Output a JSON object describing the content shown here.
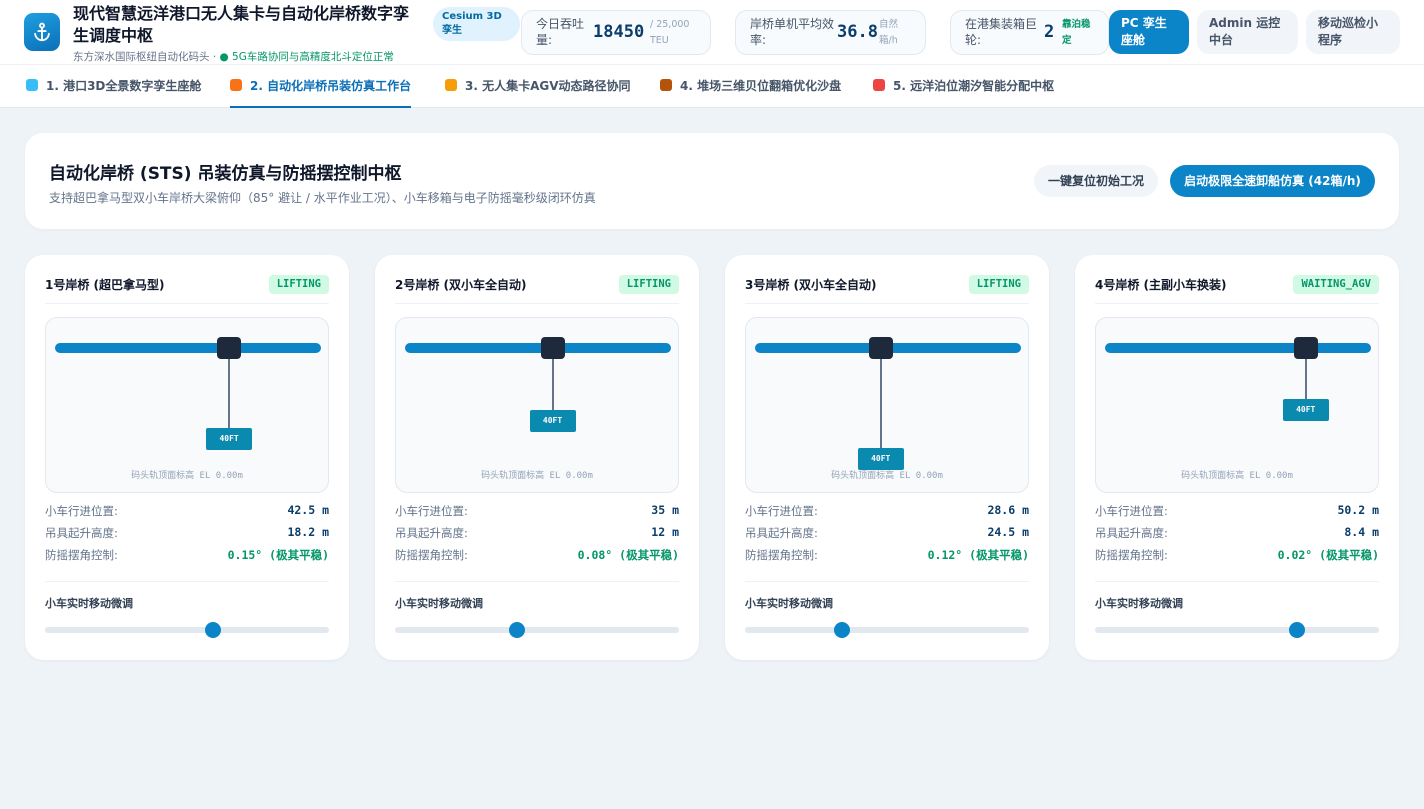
{
  "header": {
    "logo_icon": "anchor-icon",
    "title": "现代智慧远洋港口无人集卡与自动化岸桥数字孪生调度中枢",
    "subtitle": "东方深水国际枢纽自动化码头 · ",
    "subtitle_status": "● 5G车路协同与高精度北斗定位正常",
    "cesium_chip": "Cesium 3D 孪生",
    "kpis": [
      {
        "label": "今日吞吐量:",
        "value": "18450",
        "unit": "/ 25,000 TEU"
      },
      {
        "label": "岸桥单机平均效率:",
        "value": "36.8",
        "unit": "自然箱/h"
      },
      {
        "label": "在港集装箱巨轮:",
        "value": "2",
        "unit": "靠泊稳定"
      }
    ],
    "nav": [
      {
        "label": "PC 孪生座舱",
        "active": true
      },
      {
        "label": "Admin 运控中台",
        "active": false
      },
      {
        "label": "移动巡检小程序",
        "active": false
      }
    ]
  },
  "tabs": [
    {
      "label": "1. 港口3D全景数字孪生座舱",
      "icon": "globe-icon",
      "color": "#38bdf8"
    },
    {
      "label": "2. 自动化岸桥吊装仿真工作台",
      "icon": "crane-icon",
      "color": "#f97316"
    },
    {
      "label": "3. 无人集卡AGV动态路径协同",
      "icon": "truck-icon",
      "color": "#f59e0b"
    },
    {
      "label": "4. 堆场三维贝位翻箱优化沙盘",
      "icon": "package-icon",
      "color": "#b45309"
    },
    {
      "label": "5. 远洋泊位潮汐智能分配中枢",
      "icon": "ship-icon",
      "color": "#ef4444"
    }
  ],
  "hero": {
    "title": "自动化岸桥 (STS) 吊装仿真与防摇摆控制中枢",
    "subtitle": "支持超巴拿马型双小车岸桥大梁俯仰（85° 避让 / 水平作业工况）、小车移箱与电子防摇毫秒级闭环仿真",
    "reset_button": "一键复位初始工况",
    "start_button": "启动极限全速卸船仿真 (42箱/h)"
  },
  "labels": {
    "trolley_pos": "小车行进位置:",
    "hoist_height": "吊具起升高度:",
    "anti_sway": "防摇摆角控制:",
    "ground_ref": "码头轨顶面标高 EL 0.00m",
    "slider_label": "小车实时移动微调"
  },
  "cranes": [
    {
      "name": "1号岸桥 (超巴拿马型)",
      "status": "LIFTING",
      "container": "40FT",
      "trolley_pos": "42.5 m",
      "hoist_height": "18.2 m",
      "sway": "0.15° (极其平稳)",
      "trolley_ratio": 0.67,
      "hoist_ratio": 0.55,
      "slider_ratio": 0.59
    },
    {
      "name": "2号岸桥 (双小车全自动)",
      "status": "LIFTING",
      "container": "40FT",
      "trolley_pos": "35 m",
      "hoist_height": "12 m",
      "sway": "0.08° (极其平稳)",
      "trolley_ratio": 0.56,
      "hoist_ratio": 0.37,
      "slider_ratio": 0.43
    },
    {
      "name": "3号岸桥 (双小车全自动)",
      "status": "LIFTING",
      "container": "40FT",
      "trolley_pos": "28.6 m",
      "hoist_height": "24.5 m",
      "sway": "0.12° (极其平稳)",
      "trolley_ratio": 0.47,
      "hoist_ratio": 0.76,
      "slider_ratio": 0.34
    },
    {
      "name": "4号岸桥 (主副小车换装)",
      "status": "WAITING_AGV",
      "container": "40FT",
      "trolley_pos": "50.2 m",
      "hoist_height": "8.4 m",
      "sway": "0.02° (极其平稳)",
      "trolley_ratio": 0.78,
      "hoist_ratio": 0.25,
      "slider_ratio": 0.71
    }
  ]
}
